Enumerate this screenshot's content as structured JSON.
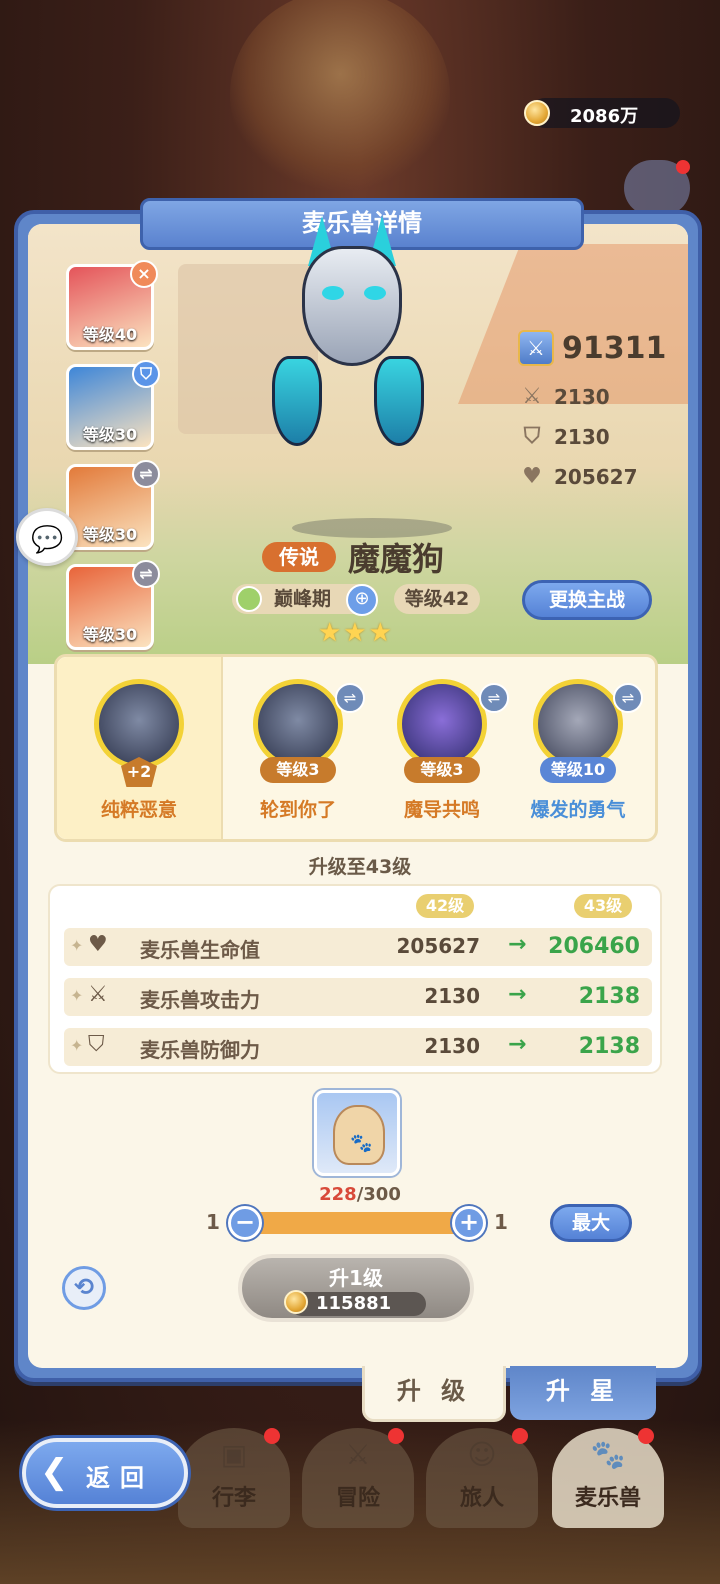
{
  "currency": {
    "amount": "2086万"
  },
  "panel": {
    "title": "麦乐兽详情"
  },
  "side_cards": [
    {
      "level": "等级40",
      "badge": "×",
      "color": "#e4545a",
      "badge_color": "#f08a5a"
    },
    {
      "level": "等级30",
      "badge": "⛉",
      "color": "#3e86d8",
      "badge_color": "#5a94e8"
    },
    {
      "level": "等级30",
      "badge": "⇌",
      "color": "#e27a3a",
      "badge_color": "#8c8c9c"
    },
    {
      "level": "等级30",
      "badge": "⇌",
      "color": "#e8643a",
      "badge_color": "#8c8c9c"
    }
  ],
  "stats": {
    "power": "91311",
    "attack": "2130",
    "defense": "2130",
    "hp": "205627"
  },
  "pet": {
    "rarity": "传说",
    "name": "魔魔狗",
    "stage": "巅峰期",
    "level": "等级42",
    "stars": "★★★",
    "switch_label": "更换主战"
  },
  "skills": [
    {
      "name": "纯粹恶意",
      "level": "+2",
      "name_color": "#d57a26"
    },
    {
      "name": "轮到你了",
      "level": "等级3",
      "name_color": "#d57a26"
    },
    {
      "name": "魔导共鸣",
      "level": "等级3",
      "name_color": "#d57a26"
    },
    {
      "name": "爆发的勇气",
      "level": "等级10",
      "name_color": "#4a8fd8"
    }
  ],
  "upgrade": {
    "title": "升级至43级",
    "current_level": "42级",
    "next_level": "43级",
    "rows": [
      {
        "label": "麦乐兽生命值",
        "icon": "heart-icon",
        "old": "205627",
        "new": "206460"
      },
      {
        "label": "麦乐兽攻击力",
        "icon": "swords-icon",
        "old": "2130",
        "new": "2138"
      },
      {
        "label": "麦乐兽防御力",
        "icon": "shield-icon",
        "old": "2130",
        "new": "2138"
      }
    ]
  },
  "item": {
    "have": "228",
    "need": "/300"
  },
  "slider": {
    "min": "1",
    "max": "1",
    "fill_fraction": 1.0
  },
  "buttons": {
    "max": "最大",
    "level_up": "升1级",
    "cost": "115881",
    "back": "返回"
  },
  "tabs": {
    "upgrade": "升 级",
    "star": "升 星"
  },
  "nav": [
    {
      "label": "行李"
    },
    {
      "label": "冒险"
    },
    {
      "label": "旅人"
    },
    {
      "label": "麦乐兽"
    }
  ]
}
